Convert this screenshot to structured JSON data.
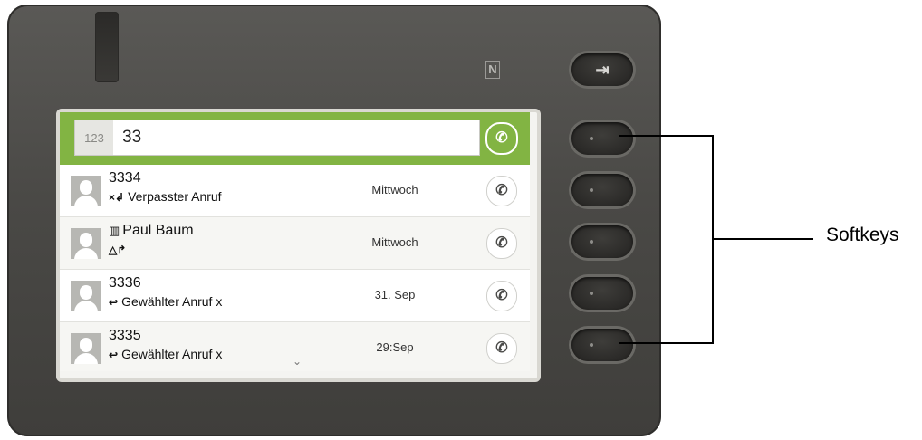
{
  "device": {
    "nfc_symbol": "N",
    "logout_icon": "logout-icon"
  },
  "dialer": {
    "mode_label": "123",
    "entered_digits": "33",
    "call_icon": "phone-icon"
  },
  "list": {
    "rows": [
      {
        "name": "3334",
        "subtext": "Verpasster Anruf",
        "subtext_icon": "×↲",
        "date": "Mittwoch"
      },
      {
        "name": "Paul Baum",
        "name_icon": "▥",
        "subtext": "",
        "subtext_icon": "△↱",
        "date": "Mittwoch"
      },
      {
        "name": "3336",
        "subtext": "Gewählter Anruf x",
        "subtext_icon": "↩",
        "date": "31. Sep"
      },
      {
        "name": "3335",
        "subtext": "Gewählter Anruf x",
        "subtext_icon": "↩",
        "date": "29:Sep"
      }
    ],
    "scroll_indicator": "⌄"
  },
  "callout": {
    "label": "Softkeys"
  },
  "colors": {
    "accent_green": "#82b443",
    "housing": "#4a4946"
  }
}
